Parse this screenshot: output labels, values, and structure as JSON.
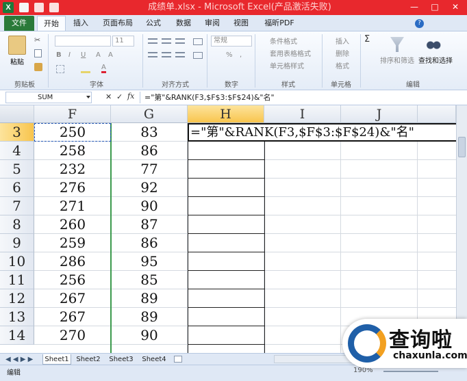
{
  "window": {
    "title": "成绩单.xlsx - Microsoft Excel(产品激活失败)"
  },
  "ribbon_tabs": [
    {
      "label": "文件"
    },
    {
      "label": "开始"
    },
    {
      "label": "插入"
    },
    {
      "label": "页面布局"
    },
    {
      "label": "公式"
    },
    {
      "label": "数据"
    },
    {
      "label": "审阅"
    },
    {
      "label": "视图"
    },
    {
      "label": "福昕PDF"
    }
  ],
  "groups": {
    "clipboard": "剪贴板",
    "font": "字体",
    "alignment": "对齐方式",
    "number": "数字",
    "styles": "样式",
    "cells": "单元格",
    "editing": "编辑"
  },
  "ribbon": {
    "paste": "粘贴",
    "font_size": "11",
    "number_format": "常规",
    "cond_format": "条件格式",
    "table_format": "套用表格格式",
    "cell_style": "单元格样式",
    "insert": "插入",
    "delete": "删除",
    "format": "格式",
    "sort": "排序和筛选",
    "find": "查找和选择",
    "sigma": "Σ",
    "bold": "B",
    "italic": "I",
    "underline": "U",
    "font_a": "A",
    "percent": "%",
    "comma": ",",
    "fx": "fx"
  },
  "formula_bar": {
    "name_box": "SUM",
    "formula": "=\"第\"&RANK(F3,$F$3:$F$24)&\"名\"",
    "cancel": "✕",
    "enter": "✓"
  },
  "columns": [
    "F",
    "G",
    "H",
    "I",
    "J"
  ],
  "rows": [
    {
      "num": "3",
      "f": "250",
      "g": "83"
    },
    {
      "num": "4",
      "f": "258",
      "g": "86"
    },
    {
      "num": "5",
      "f": "232",
      "g": "77"
    },
    {
      "num": "6",
      "f": "276",
      "g": "92"
    },
    {
      "num": "7",
      "f": "271",
      "g": "90"
    },
    {
      "num": "8",
      "f": "260",
      "g": "87"
    },
    {
      "num": "9",
      "f": "259",
      "g": "86"
    },
    {
      "num": "10",
      "f": "286",
      "g": "95"
    },
    {
      "num": "11",
      "f": "256",
      "g": "85"
    },
    {
      "num": "12",
      "f": "267",
      "g": "89"
    },
    {
      "num": "13",
      "f": "267",
      "g": "89"
    },
    {
      "num": "14",
      "f": "270",
      "g": "90"
    }
  ],
  "active_cell_text": "=\"第\"&RANK(F3,$F$3:$F$24)&\"名\"",
  "sheets": [
    "Sheet1",
    "Sheet2",
    "Sheet3",
    "Sheet4"
  ],
  "status": {
    "mode": "编辑",
    "zoom": "190%"
  },
  "watermark": {
    "brand": "查询啦",
    "url": "chaxunla.com"
  },
  "colors": {
    "titlebar": "#e8282d",
    "accent": "#1f5fa8",
    "file_tab": "#2a7a39"
  }
}
